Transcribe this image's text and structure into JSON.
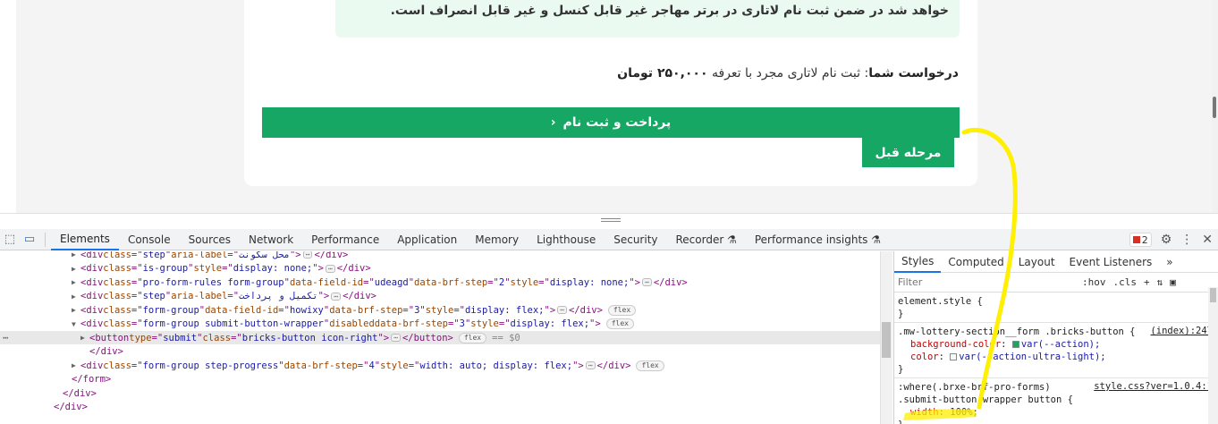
{
  "page": {
    "notice_text": "خواهد شد در ضمن ثبت نام لاتاری در برتر مهاجر غیر قابل کنسل و غیر قابل انصراف است.",
    "request_label": "درخواست شما",
    "request_text": ": ثبت نام لاتاری مجرد با تعرفه",
    "request_price": "۲۵۰,۰۰۰ تومان",
    "submit_label": "پرداخت و ثبت نام",
    "submit_icon": "chevron-left-icon",
    "prev_label": "مرحله قبل"
  },
  "devtools": {
    "tabs": [
      "Elements",
      "Console",
      "Sources",
      "Network",
      "Performance",
      "Application",
      "Memory",
      "Lighthouse",
      "Security",
      "Recorder ⚗",
      "Performance insights ⚗"
    ],
    "active_tab": "Elements",
    "issues_count": "2",
    "elements": [
      {
        "indent": 0,
        "tri": "▶",
        "tag": "div",
        "attrs": [
          [
            "class",
            "step"
          ],
          [
            "aria-label",
            "محل سکونت"
          ]
        ],
        "ellipsis": true,
        "close": "</div>",
        "flex": false
      },
      {
        "indent": 0,
        "tri": "▶",
        "tag": "div",
        "attrs": [
          [
            "class",
            "is-group"
          ],
          [
            "style",
            "display: none;"
          ]
        ],
        "ellipsis": true,
        "close": "</div>",
        "flex": false
      },
      {
        "indent": 0,
        "tri": "▶",
        "tag": "div",
        "attrs": [
          [
            "class",
            "pro-form-rules form-group"
          ],
          [
            "data-field-id",
            "udeagd"
          ],
          [
            "data-brf-step",
            "2"
          ],
          [
            "style",
            "display: none;"
          ]
        ],
        "ellipsis": true,
        "close": "</div>",
        "flex": false
      },
      {
        "indent": 0,
        "tri": "▶",
        "tag": "div",
        "attrs": [
          [
            "class",
            "step"
          ],
          [
            "aria-label",
            "تکمیل و پرداخت"
          ]
        ],
        "ellipsis": true,
        "close": "</div>",
        "flex": false
      },
      {
        "indent": 0,
        "tri": "▶",
        "tag": "div",
        "attrs": [
          [
            "class",
            "form-group"
          ],
          [
            "data-field-id",
            "howixy"
          ],
          [
            "data-brf-step",
            "3"
          ],
          [
            "style",
            "display: flex;"
          ]
        ],
        "ellipsis": true,
        "close": "</div>",
        "flex": true
      },
      {
        "indent": 0,
        "tri": "▼",
        "tag": "div",
        "attrs": [
          [
            "class",
            "form-group submit-button-wrapper"
          ],
          [
            "disabled",
            ""
          ],
          [
            "data-brf-step",
            "3"
          ],
          [
            "style",
            "display: flex;"
          ]
        ],
        "ellipsis": false,
        "close": "",
        "flex": true
      },
      {
        "indent": 1,
        "tri": "▶",
        "tag": "button",
        "attrs": [
          [
            "type",
            "submit"
          ],
          [
            "class",
            "bricks-button icon-right"
          ]
        ],
        "ellipsis": true,
        "close": "</button>",
        "flex": true,
        "selected": true,
        "dollar": "== $0"
      },
      {
        "indent": 1,
        "tri": "",
        "tag": "",
        "attrs": [],
        "ellipsis": false,
        "close": "</div>",
        "flex": false
      },
      {
        "indent": 0,
        "tri": "▶",
        "tag": "div",
        "attrs": [
          [
            "class",
            "form-group step-progress"
          ],
          [
            "data-brf-step",
            "4"
          ],
          [
            "style",
            "width: auto; display: flex;"
          ]
        ],
        "ellipsis": true,
        "close": "</div>",
        "flex": true
      },
      {
        "indent": -1,
        "tri": "",
        "tag": "",
        "attrs": [],
        "ellipsis": false,
        "close": "</form>",
        "flex": false
      },
      {
        "indent": -2,
        "tri": "",
        "tag": "",
        "attrs": [],
        "ellipsis": false,
        "close": "</div>",
        "flex": false
      },
      {
        "indent": -3,
        "tri": "",
        "tag": "",
        "attrs": [],
        "ellipsis": false,
        "close": "</div>",
        "flex": false
      }
    ],
    "styles_tabs": [
      "Styles",
      "Computed",
      "Layout",
      "Event Listeners",
      "»"
    ],
    "filter_placeholder": "Filter",
    "filter_tools": [
      ":hov",
      ".cls",
      "+",
      "⇅",
      "▣"
    ],
    "rules": [
      {
        "selector": "element.style {",
        "source": "",
        "props": [],
        "close": "}"
      },
      {
        "selector": ".mw-lottery-section__form .bricks-button {",
        "source": "(index):247",
        "props": [
          {
            "name": "background-color",
            "value": "var(--action);",
            "swatch": "#16a765"
          },
          {
            "name": "color",
            "value": "var(--action-ultra-light);",
            "swatch": "#f2fbf6"
          }
        ],
        "close": "}"
      },
      {
        "selector": ":where(.brxe-brf-pro-forms)",
        "selector2": ".submit-button-wrapper button {",
        "source": "style.css?ver=1.0.4:1",
        "props": [
          {
            "name": "width",
            "value": "100%;",
            "swatch": ""
          }
        ],
        "close": "}"
      }
    ]
  }
}
